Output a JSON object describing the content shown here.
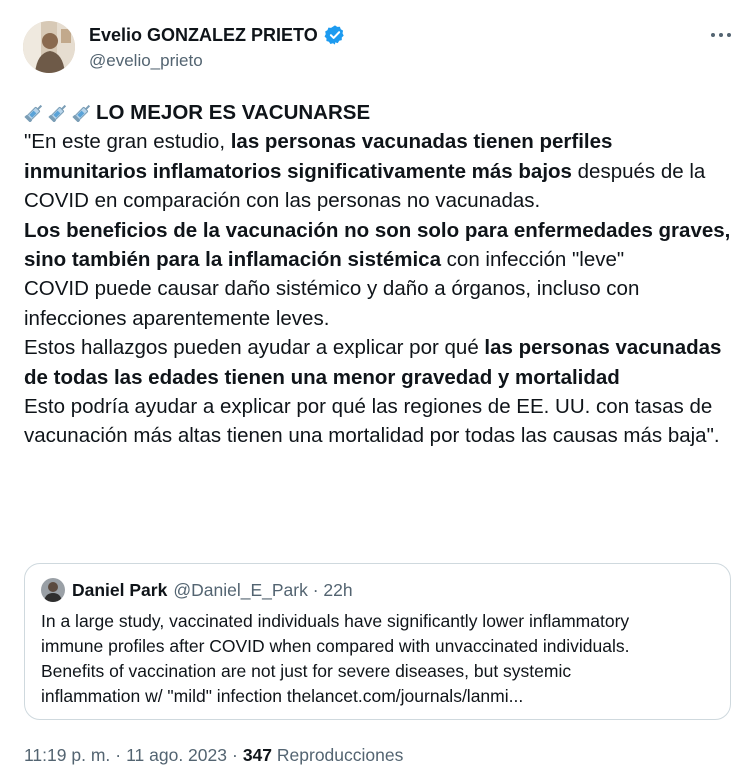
{
  "author": {
    "display_name": "Evelio GONZALEZ PRIETO",
    "handle": "@evelio_prieto",
    "verified_color": "#1d9bf0"
  },
  "more_icon": "more-horizontal-icon",
  "body": {
    "title_prefix_icons": [
      "syringe-icon",
      "syringe-icon",
      "syringe-icon"
    ],
    "title": "LO MEJOR ES VACUNARSE",
    "p1_a": "\"En este gran estudio, ",
    "p1_b": "las personas vacunadas tienen perfiles inmunitarios inflamatorios significativamente más bajos",
    "p1_c": " después de la COVID en comparación con las personas no vacunadas.",
    "p2_a": "Los beneficios de la vacunación no son solo para enfermedades graves, sino también para la inflamación sistémica",
    "p2_b": " con infección \"leve\"",
    "p3": "COVID puede causar daño sistémico y daño a órganos, incluso con infecciones aparentemente leves.",
    "p4_a": "Estos hallazgos pueden ayudar a explicar por qué ",
    "p4_b": "las personas vacunadas de todas las edades tienen una menor gravedad y mortalidad",
    "p5": "Esto podría ayudar a explicar por qué las regiones de EE. UU. con tasas de vacunación más altas tienen una mortalidad por todas las causas más baja\"."
  },
  "quote": {
    "name": "Daniel Park",
    "handle": "@Daniel_E_Park",
    "separator": "·",
    "time": "22h",
    "text_line1": "In a large study, vaccinated individuals have significantly lower inflammatory",
    "text_line2": "immune profiles after COVID when compared with unvaccinated individuals.",
    "text_line3": "Benefits of vaccination are not just for severe diseases, but systemic",
    "text_line4": "inflammation w/ \"mild\" infection thelancet.com/journals/lanmi..."
  },
  "meta": {
    "time": "11:19 p. m.",
    "sep1": "·",
    "date": "11 ago. 2023",
    "sep2": "·",
    "views_count": "347",
    "views_label": "Reproducciones"
  },
  "colors": {
    "text_primary": "#0f1419",
    "text_secondary": "#536471",
    "border": "#cfd9de",
    "verified": "#1d9bf0"
  }
}
